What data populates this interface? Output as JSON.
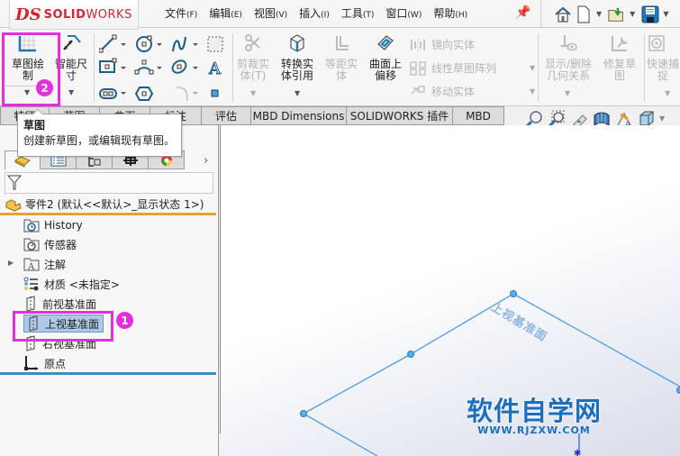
{
  "app": {
    "logo_prefix": "DS",
    "logo_solid": "SOLID",
    "logo_works": "WORKS"
  },
  "menu": [
    {
      "label": "文件",
      "key": "(F)"
    },
    {
      "label": "编辑",
      "key": "(E)"
    },
    {
      "label": "视图",
      "key": "(V)"
    },
    {
      "label": "插入",
      "key": "(I)"
    },
    {
      "label": "工具",
      "key": "(T)"
    },
    {
      "label": "窗口",
      "key": "(W)"
    },
    {
      "label": "帮助",
      "key": "(H)"
    }
  ],
  "quick_access": [
    "home-icon",
    "new-document-icon",
    "open-folder-icon",
    "save-icon"
  ],
  "ribbon": {
    "sketch_button": "草图绘\n制",
    "sketch_line1": "草图绘",
    "sketch_line2": "制",
    "smart_dim_line1": "智能尺",
    "smart_dim_line2": "寸",
    "trim_line1": "剪裁实",
    "trim_line2": "体(T)",
    "convert_line1": "转换实",
    "convert_line2": "体引用",
    "offset_line1": "等距实",
    "offset_line2": "体",
    "surface_offset_line1": "曲面上",
    "surface_offset_line2": "偏移",
    "mirror": "镜向实体",
    "linear_pattern": "线性草图阵列",
    "move": "移动实体",
    "relations_line1": "显示/删除",
    "relations_line2": "几何关系",
    "repair_line1": "修复草",
    "repair_line2": "图",
    "snap_line1": "快速捕",
    "snap_line2": "捉"
  },
  "tabs": [
    {
      "label": "特征"
    },
    {
      "label": "草图"
    },
    {
      "label": "曲面"
    },
    {
      "label": "标注"
    },
    {
      "label": "评估"
    },
    {
      "label": "MBD Dimensions"
    },
    {
      "label": "SOLIDWORKS 插件"
    },
    {
      "label": "MBD"
    }
  ],
  "tooltip": {
    "title": "草图",
    "body": "创建新草图，或编辑现有草图。"
  },
  "annotations": {
    "badge_1": "1",
    "badge_2": "2",
    "highlight_color": "#e52ee0"
  },
  "feature_tree": {
    "root": "零件2  (默认<<默认>_显示状态 1>)",
    "items": [
      {
        "label": "History",
        "icon": "history-folder-icon"
      },
      {
        "label": "传感器",
        "icon": "sensor-folder-icon"
      },
      {
        "label": "注解",
        "icon": "annotation-folder-icon",
        "expandable": true
      },
      {
        "label": "材质 <未指定>",
        "icon": "material-icon"
      },
      {
        "label": "前视基准面",
        "icon": "plane-icon"
      },
      {
        "label": "上视基准面",
        "icon": "plane-icon",
        "selected": true
      },
      {
        "label": "右视基准面",
        "icon": "plane-icon"
      },
      {
        "label": "原点",
        "icon": "origin-icon"
      }
    ]
  },
  "viewport": {
    "plane_label": "上视基准面",
    "watermark_cn": "软件自学网",
    "watermark_en": "WWW.RJZXW.COM"
  },
  "colors": {
    "accent_orange": "#e3a233",
    "accent_blue": "#3b8cc4",
    "plane_blue": "#4d9fe8",
    "selection": "#aec9e6"
  }
}
